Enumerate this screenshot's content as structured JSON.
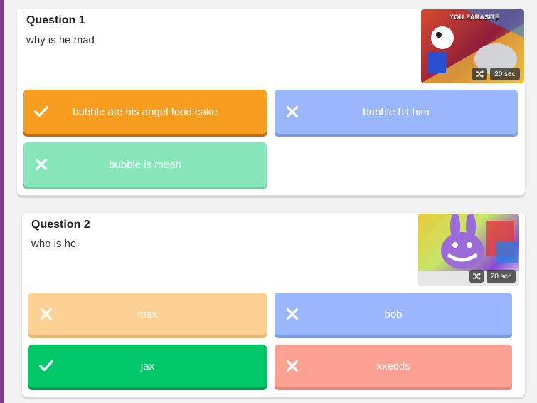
{
  "questions": [
    {
      "title": "Question 1",
      "text": "why is he mad",
      "thumb_caption": "YOU PARASITE",
      "time": "20 sec",
      "answers": [
        {
          "label": "bubble ate his angel food cake",
          "correct": true
        },
        {
          "label": "bubble bit him",
          "correct": false
        },
        {
          "label": "bubble is mean",
          "correct": false
        }
      ]
    },
    {
      "title": "Question 2",
      "text": "who is he",
      "time": "20 sec",
      "answers": [
        {
          "label": "max",
          "correct": false
        },
        {
          "label": "bob",
          "correct": false
        },
        {
          "label": "jax",
          "correct": true
        },
        {
          "label": "xxedds",
          "correct": false
        }
      ]
    }
  ],
  "icons": {
    "correct": "check-icon",
    "incorrect": "cross-icon",
    "time_setting": "shuffle-icon"
  },
  "colors": {
    "left_bar": "#7c3f8f",
    "orange": "#f79d1f",
    "blue": "#9ab7fd",
    "mint": "#86e6b9",
    "peach": "#fcd193",
    "green": "#00c768",
    "salmon": "#fba092"
  }
}
